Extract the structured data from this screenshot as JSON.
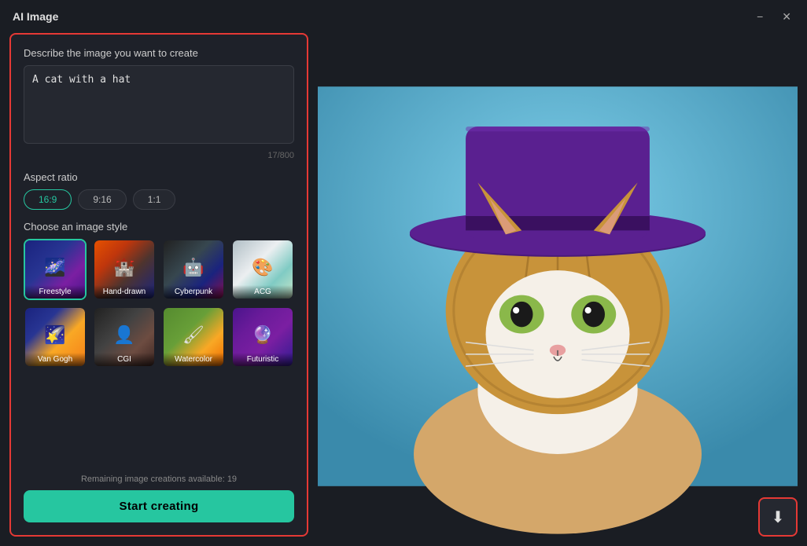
{
  "titlebar": {
    "title": "AI Image",
    "minimize_label": "−",
    "close_label": "✕"
  },
  "left_panel": {
    "prompt_section": {
      "label": "Describe the image you want to create",
      "value": "A cat with a hat",
      "char_count": "17/800"
    },
    "aspect_ratio": {
      "label": "Aspect ratio",
      "options": [
        "16:9",
        "9:16",
        "1:1"
      ],
      "active": "16:9"
    },
    "style_section": {
      "label": "Choose an image style",
      "styles": [
        {
          "id": "freestyle",
          "label": "Freestyle",
          "active": true
        },
        {
          "id": "handdrawn",
          "label": "Hand-drawn",
          "active": false
        },
        {
          "id": "cyberpunk",
          "label": "Cyberpunk",
          "active": false
        },
        {
          "id": "acg",
          "label": "ACG",
          "active": false
        },
        {
          "id": "vangogh",
          "label": "Van Gogh",
          "active": false
        },
        {
          "id": "cgi",
          "label": "CGI",
          "active": false
        },
        {
          "id": "watercolor",
          "label": "Watercolor",
          "active": false
        },
        {
          "id": "futuristic",
          "label": "Futuristic",
          "active": false
        }
      ]
    },
    "remaining_text": "Remaining image creations available: 19",
    "start_button_label": "Start creating"
  },
  "right_panel": {
    "download_icon": "⬇"
  }
}
